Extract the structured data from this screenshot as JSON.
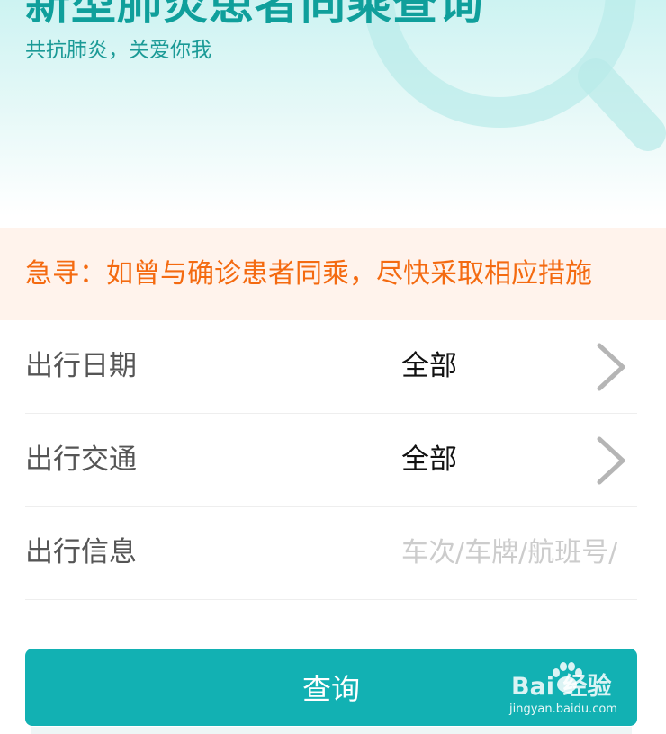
{
  "header": {
    "title": "新型肺炎患者同乘查询",
    "subtitle": "共抗肺炎，关爱你我"
  },
  "alert": {
    "text": "急寻：如曾与确诊患者同乘，尽快采取相应措施"
  },
  "form": {
    "date": {
      "label": "出行日期",
      "value": "全部"
    },
    "transport": {
      "label": "出行交通",
      "value": "全部"
    },
    "info": {
      "label": "出行信息",
      "placeholder": "车次/车牌/航班号/"
    }
  },
  "search_button": {
    "label": "查询"
  },
  "watermark": {
    "text": "Bai 经验",
    "url": "jingyan.baidu.com"
  },
  "colors": {
    "brand": "#12b1b3",
    "title": "#0f9f9b",
    "alert_text": "#f46a10",
    "alert_bg": "#fff3ec"
  },
  "icons": [
    "magnifier-icon",
    "chevron-right-icon",
    "baidu-paw-icon"
  ]
}
